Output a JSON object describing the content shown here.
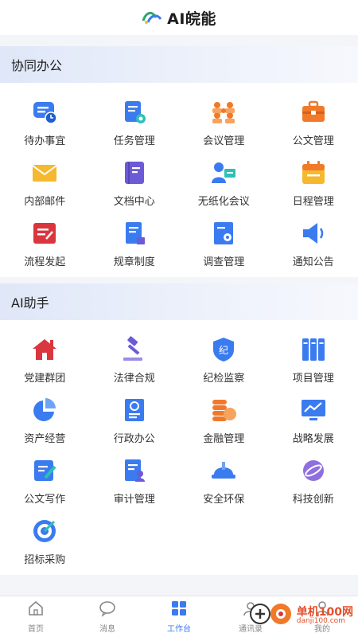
{
  "header": {
    "title": "AI皖能"
  },
  "sections": [
    {
      "title": "协同办公",
      "items": [
        {
          "label": "待办事宜",
          "icon": "todo-icon"
        },
        {
          "label": "任务管理",
          "icon": "task-icon"
        },
        {
          "label": "会议管理",
          "icon": "meeting-icon"
        },
        {
          "label": "公文管理",
          "icon": "briefcase-icon"
        },
        {
          "label": "内部邮件",
          "icon": "mail-icon"
        },
        {
          "label": "文档中心",
          "icon": "book-icon"
        },
        {
          "label": "无纸化会议",
          "icon": "presenter-icon"
        },
        {
          "label": "日程管理",
          "icon": "calendar-icon"
        },
        {
          "label": "流程发起",
          "icon": "flow-icon"
        },
        {
          "label": "规章制度",
          "icon": "rules-icon"
        },
        {
          "label": "调查管理",
          "icon": "survey-icon"
        },
        {
          "label": "通知公告",
          "icon": "speaker-icon"
        }
      ]
    },
    {
      "title": "AI助手",
      "items": [
        {
          "label": "党建群团",
          "icon": "house-icon"
        },
        {
          "label": "法律合规",
          "icon": "gavel-icon"
        },
        {
          "label": "纪检监察",
          "icon": "shield-icon"
        },
        {
          "label": "项目管理",
          "icon": "columns-icon"
        },
        {
          "label": "资产经营",
          "icon": "pie-icon"
        },
        {
          "label": "行政办公",
          "icon": "document-icon"
        },
        {
          "label": "金融管理",
          "icon": "coins-icon"
        },
        {
          "label": "战略发展",
          "icon": "monitor-chart-icon"
        },
        {
          "label": "公文写作",
          "icon": "write-icon"
        },
        {
          "label": "审计管理",
          "icon": "audit-icon"
        },
        {
          "label": "安全环保",
          "icon": "helmet-icon"
        },
        {
          "label": "科技创新",
          "icon": "planet-icon"
        },
        {
          "label": "招标采购",
          "icon": "target-icon"
        }
      ]
    }
  ],
  "nav": [
    {
      "label": "首页",
      "icon": "home-icon"
    },
    {
      "label": "消息",
      "icon": "chat-icon"
    },
    {
      "label": "工作台",
      "icon": "grid-icon"
    },
    {
      "label": "通讯录",
      "icon": "contacts-icon"
    },
    {
      "label": "我的",
      "icon": "user-icon"
    }
  ],
  "watermark": {
    "cn": "单机100网",
    "en": "danji100.com"
  },
  "colors": {
    "accent": "#3a7bf0",
    "orange": "#f07a2a",
    "red": "#d9363e",
    "purple": "#6b5bd6",
    "yellow": "#f5b82e"
  }
}
